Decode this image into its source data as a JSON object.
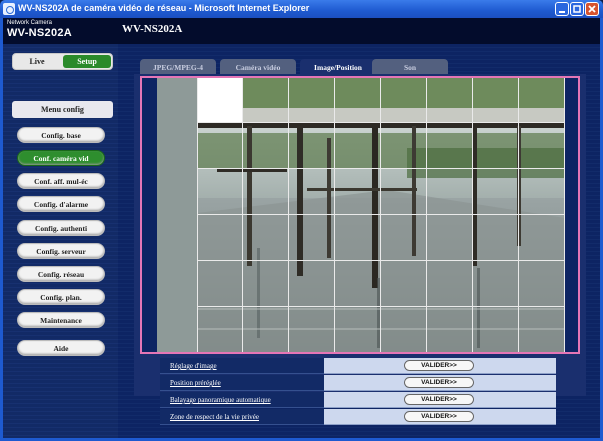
{
  "window": {
    "title": "WV-NS202A de caméra vidéo de réseau - Microsoft Internet Explorer"
  },
  "header": {
    "brand_small": "Network Camera",
    "brand_model": "WV-NS202A",
    "page_title": "WV-NS202A"
  },
  "sidebar": {
    "live_label": "Live",
    "setup_label": "Setup",
    "menu_header": "Menu config",
    "items": [
      {
        "label": "Config. base",
        "active": false
      },
      {
        "label": "Conf. caméra vid",
        "active": true
      },
      {
        "label": "Conf. aff. mul-éc",
        "active": false
      },
      {
        "label": "Config. d'alarme",
        "active": false
      },
      {
        "label": "Config. authenti",
        "active": false
      },
      {
        "label": "Config. serveur",
        "active": false
      },
      {
        "label": "Config. réseau",
        "active": false
      },
      {
        "label": "Config. plan.",
        "active": false
      },
      {
        "label": "Maintenance",
        "active": false
      }
    ],
    "help_label": "Aide"
  },
  "tabs": [
    {
      "label": "JPEG/MPEG-4",
      "active": false
    },
    {
      "label": "Caméra vidéo",
      "active": false
    },
    {
      "label": "Image/Position",
      "active": true
    },
    {
      "label": "Son",
      "active": false
    }
  ],
  "options": [
    {
      "label": "Réglage d'image",
      "button": "VALIDER>>"
    },
    {
      "label": "Position préréglée",
      "button": "VALIDER>>"
    },
    {
      "label": "Balayage panoramique automatique",
      "button": "VALIDER>>"
    },
    {
      "label": "Zone de respect de la vie privée",
      "button": "VALIDER>>"
    }
  ],
  "colors": {
    "accent_active": "#2e8e2e",
    "privacy_border": "#e576b6",
    "titlebar": "#1e5ad0"
  }
}
